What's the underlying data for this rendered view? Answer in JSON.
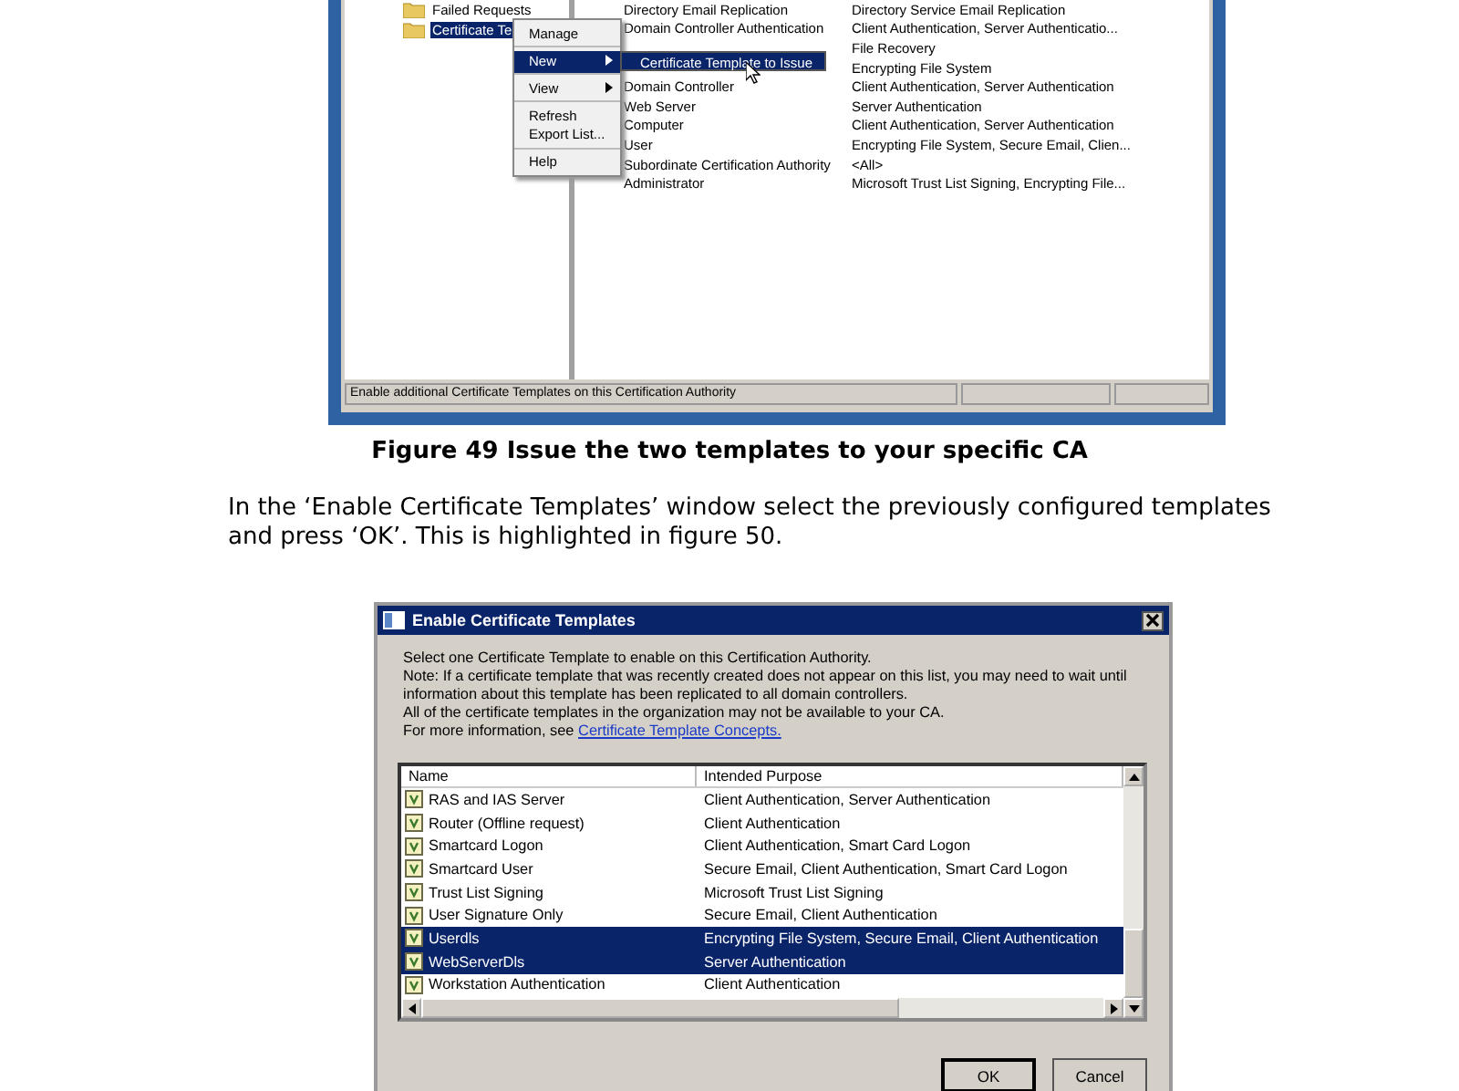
{
  "figure49": {
    "tree": [
      {
        "label": "Failed Requests",
        "selected": false
      },
      {
        "label": "Certificate Te",
        "selected": true
      }
    ],
    "context_menu": [
      {
        "label": "Manage",
        "selected": false,
        "has_submenu": false,
        "separator_after": true
      },
      {
        "label": "New",
        "selected": true,
        "has_submenu": true,
        "separator_after": true
      },
      {
        "label": "View",
        "selected": false,
        "has_submenu": true,
        "separator_after": true
      },
      {
        "label": "Refresh",
        "selected": false,
        "has_submenu": false,
        "separator_after": false
      },
      {
        "label": "Export List...",
        "selected": false,
        "has_submenu": false,
        "separator_after": true
      },
      {
        "label": "Help",
        "selected": false,
        "has_submenu": false,
        "separator_after": false
      }
    ],
    "submenu": {
      "label": "Certificate Template to Issue"
    },
    "templates": [
      {
        "name": "Directory Email Replication",
        "purpose": "Directory Service Email Replication"
      },
      {
        "name": "Domain Controller Authentication",
        "purpose": "Client Authentication, Server Authenticatio..."
      },
      {
        "purpose": "File Recovery"
      },
      {
        "purpose": "Encrypting File System"
      },
      {
        "name": "Domain Controller",
        "purpose": "Client Authentication, Server Authentication"
      },
      {
        "name": "Web Server",
        "purpose": "Server Authentication"
      },
      {
        "name": "Computer",
        "purpose": "Client Authentication, Server Authentication"
      },
      {
        "name": "User",
        "purpose": "Encrypting File System, Secure Email, Clien..."
      },
      {
        "name": "Subordinate Certification Authority",
        "purpose": "<All>"
      },
      {
        "name": "Administrator",
        "purpose": "Microsoft Trust List Signing, Encrypting File..."
      }
    ],
    "status_bar": "Enable additional Certificate Templates on this Certification Authority"
  },
  "caption": "Figure 49 Issue the two templates to your specific CA",
  "paragraph": "In the ‘Enable Certificate Templates’ window select the previously configured templates and press ‘OK’. This is highlighted in figure 50.",
  "dialog": {
    "title": "Enable Certificate Templates",
    "intro": [
      "Select one Certificate Template to enable on this Certification Authority.",
      "Note: If a certificate template that was recently created does not appear on this list, you may need to wait until information about this template has been replicated to all domain controllers.",
      "All of the certificate templates in the organization may not be available to your CA."
    ],
    "link_prefix": "For more information, see",
    "link": "Certificate Template Concepts.",
    "columns": [
      "Name",
      "Intended Purpose"
    ],
    "rows": [
      {
        "name": "RAS and IAS Server",
        "purpose": "Client Authentication, Server Authentication",
        "selected": false
      },
      {
        "name": "Router (Offline request)",
        "purpose": "Client Authentication",
        "selected": false
      },
      {
        "name": "Smartcard Logon",
        "purpose": "Client Authentication, Smart Card Logon",
        "selected": false
      },
      {
        "name": "Smartcard User",
        "purpose": "Secure Email, Client Authentication, Smart Card Logon",
        "selected": false
      },
      {
        "name": "Trust List Signing",
        "purpose": "Microsoft Trust List Signing",
        "selected": false
      },
      {
        "name": "User Signature Only",
        "purpose": "Secure Email, Client Authentication",
        "selected": false
      },
      {
        "name": "Userdls",
        "purpose": "Encrypting File System, Secure Email, Client Authentication",
        "selected": true
      },
      {
        "name": "WebServerDls",
        "purpose": "Server Authentication",
        "selected": true
      },
      {
        "name": "Workstation Authentication",
        "purpose": "Client Authentication",
        "selected": false
      }
    ],
    "buttons": [
      {
        "label": "OK",
        "default": true
      },
      {
        "label": "Cancel",
        "default": false
      }
    ]
  }
}
